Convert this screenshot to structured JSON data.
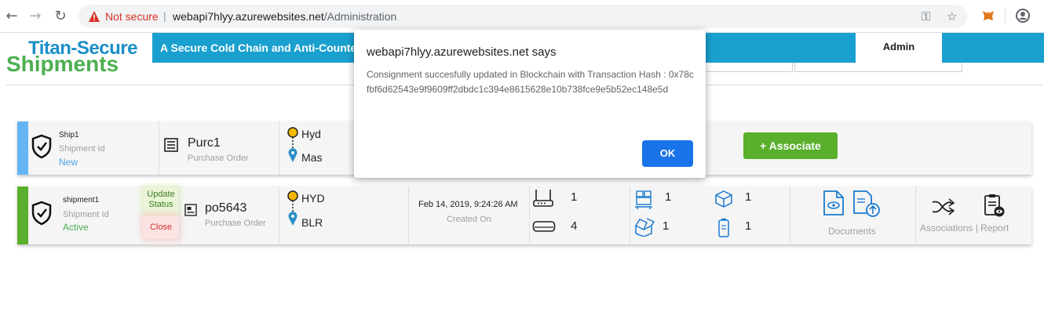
{
  "browser": {
    "security_label": "Not secure",
    "url_host": "webapi7hlyy.azurewebsites.net",
    "url_path": "/Administration"
  },
  "header": {
    "brand": "Titan-Secure",
    "tagline": "A Secure Cold Chain and Anti-Counter",
    "admin_tab": "Admin"
  },
  "page": {
    "title": "Shipments"
  },
  "shipments": [
    {
      "name": "Ship1",
      "id_label": "Shipment Id",
      "status": "New",
      "po": "Purc1",
      "po_label": "Purchase Order",
      "from": "Hyd",
      "to": "Mas",
      "associate_label": "+ Associate"
    },
    {
      "name": "shipment1",
      "id_label": "Shipment Id",
      "status": "Active",
      "update_label": "Update Status",
      "close_label": "Close",
      "po": "po5643",
      "po_label": "Purchase Order",
      "from": "HYD",
      "to": "BLR",
      "created_on": "Feb 14, 2019, 9:24:26 AM",
      "created_label": "Created On",
      "counts": {
        "router": "1",
        "sensor": "4",
        "pallets": "1",
        "open_box": "1",
        "package": "1",
        "device": "1"
      },
      "documents_label": "Documents",
      "associations_label": "Associations | Report"
    }
  ],
  "dialog": {
    "title": "webapi7hlyy.azurewebsites.net says",
    "message": "Consignment succesfully updated in Blockchain with Transaction Hash : 0x78cfbf6d62543e9f9609ff2dbdc1c394e8615628e10b738fce9e5b52ec148e5d",
    "ok_label": "OK"
  },
  "colors": {
    "brand": "#1a8fc6",
    "header_bar": "#1aa0cf",
    "title_green": "#4caf50",
    "new_stripe": "#64b5f6",
    "active_stripe": "#5ab02d",
    "icon_blue": "#1a7bd0",
    "dialog_button": "#1a73e8"
  }
}
